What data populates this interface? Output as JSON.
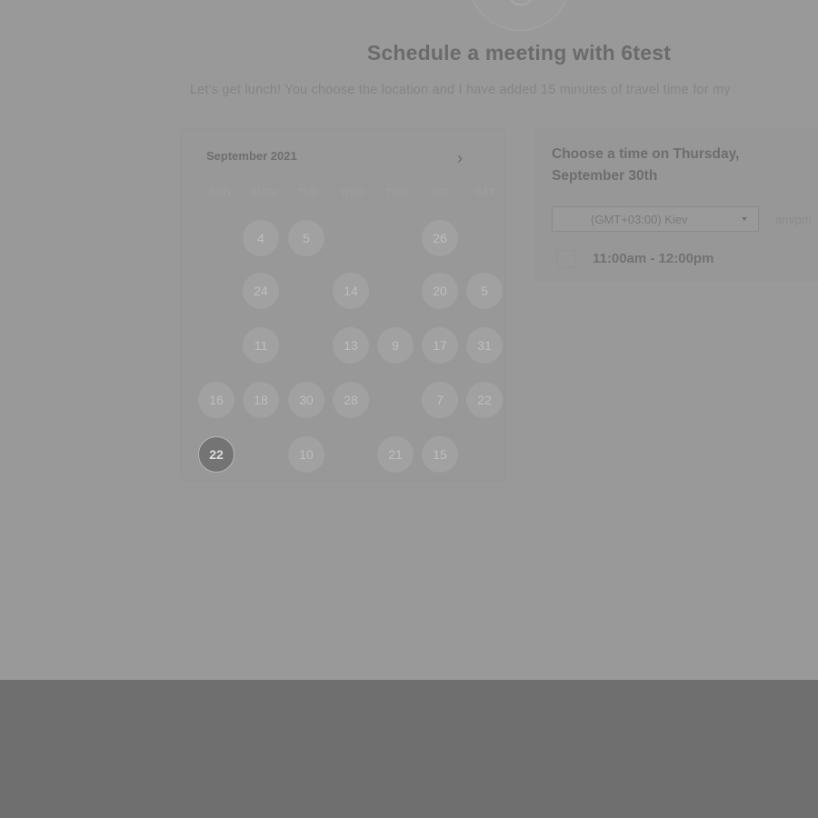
{
  "header": {
    "title": "Schedule a meeting with 6test",
    "subtitle": "Let's get lunch! You choose the location and I have added 15 minutes of travel time for my"
  },
  "calendar": {
    "month_label": "September 2021",
    "next_icon": "chevron-right-icon",
    "weekdays": [
      "SUN",
      "MON",
      "TUE",
      "WED",
      "THU",
      "FRI",
      "SAT"
    ],
    "days": [
      {
        "label": "4"
      },
      {
        "label": "5"
      },
      {
        "label": "26"
      },
      {
        "label": "24"
      },
      {
        "label": "14"
      },
      {
        "label": "20"
      },
      {
        "label": "5"
      },
      {
        "label": "11"
      },
      {
        "label": "13"
      },
      {
        "label": "9"
      },
      {
        "label": "17"
      },
      {
        "label": "31"
      },
      {
        "label": "16"
      },
      {
        "label": "18"
      },
      {
        "label": "30"
      },
      {
        "label": "28"
      },
      {
        "label": "7"
      },
      {
        "label": "22"
      },
      {
        "label": "22",
        "selected": true
      },
      {
        "label": "10"
      },
      {
        "label": "21"
      },
      {
        "label": "15"
      }
    ]
  },
  "times": {
    "heading": "Choose a time on Thursday, September 30th",
    "timezone": "(GMT+03:00) Kiev",
    "format": "am/pm",
    "slots": [
      {
        "label": "11:00am - 12:00pm"
      }
    ]
  },
  "colors": {
    "overlay": "#999999",
    "bottom_overlay": "#6f6f6f",
    "selected_day": "#747474"
  }
}
